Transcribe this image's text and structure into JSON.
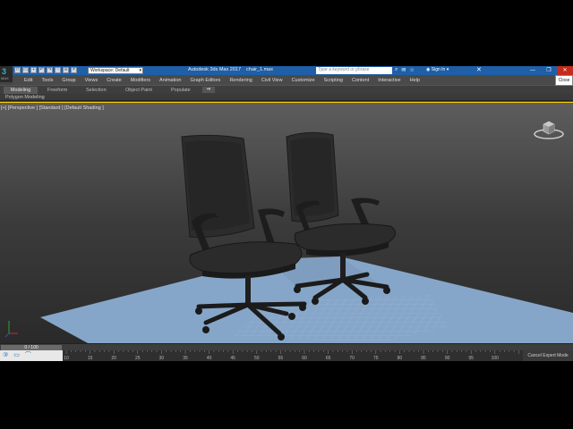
{
  "app": {
    "logo_glyph": "3",
    "logo_sub": "MAX",
    "title": "Autodesk 3ds Max 2017",
    "file_name": "chair_1.max",
    "workspace": "Workspace: Default",
    "search_placeholder": "Type a keyword or phrase",
    "sign_in": "Sign In",
    "close_tooltip": "Close"
  },
  "quick_access": [
    "new-icon",
    "open-icon",
    "save-icon",
    "undo-icon",
    "redo-icon",
    "project-icon",
    "link-icon",
    "unlink-icon"
  ],
  "menus": [
    "Edit",
    "Tools",
    "Group",
    "Views",
    "Create",
    "Modifiers",
    "Animation",
    "Graph Editors",
    "Rendering",
    "Civil View",
    "Customize",
    "Scripting",
    "Content",
    "Interactive",
    "Help"
  ],
  "ribbon": {
    "tabs": [
      "Modeling",
      "Freeform",
      "Selection",
      "Object Paint",
      "Populate"
    ],
    "active_tab": "Modeling",
    "sub_label": "Polygon Modeling"
  },
  "viewport": {
    "label": "[+] [Perspective ] [Standard ] [Default Shading ]",
    "border_color": "#ffd000",
    "ground_color": "#86a6c9"
  },
  "timeline": {
    "frame_counter": "0 / 100",
    "ticks": [
      "10",
      "15",
      "20",
      "25",
      "30",
      "35",
      "40",
      "45",
      "50",
      "55",
      "60",
      "65",
      "70",
      "75",
      "80",
      "85",
      "90",
      "95",
      "100"
    ]
  },
  "status": {
    "cancel_expert": "Cancel Expert Mode"
  }
}
